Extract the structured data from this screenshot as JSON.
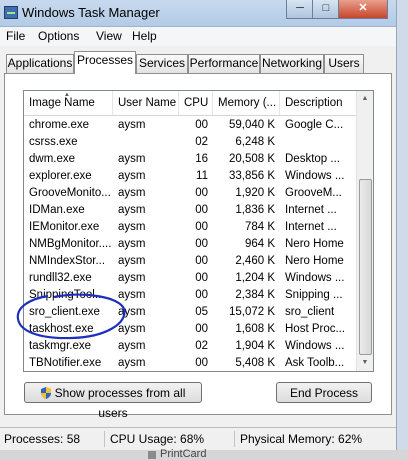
{
  "window": {
    "title": "Windows Task Manager",
    "min_glyph": "─",
    "max_glyph": "□",
    "close_glyph": "✕"
  },
  "menu": [
    "File",
    "Options",
    "View",
    "Help"
  ],
  "tabs": [
    "Applications",
    "Processes",
    "Services",
    "Performance",
    "Networking",
    "Users"
  ],
  "active_tab": "Processes",
  "columns": [
    "Image Name",
    "User Name",
    "CPU",
    "Memory (...",
    "Description"
  ],
  "processes": [
    {
      "name": "chrome.exe",
      "user": "aysm",
      "cpu": "00",
      "mem": "59,040 K",
      "desc": "Google C..."
    },
    {
      "name": "csrss.exe",
      "user": "",
      "cpu": "02",
      "mem": "6,248 K",
      "desc": ""
    },
    {
      "name": "dwm.exe",
      "user": "aysm",
      "cpu": "16",
      "mem": "20,508 K",
      "desc": "Desktop ..."
    },
    {
      "name": "explorer.exe",
      "user": "aysm",
      "cpu": "11",
      "mem": "33,856 K",
      "desc": "Windows ..."
    },
    {
      "name": "GrooveMonito...",
      "user": "aysm",
      "cpu": "00",
      "mem": "1,920 K",
      "desc": "GrooveM..."
    },
    {
      "name": "IDMan.exe",
      "user": "aysm",
      "cpu": "00",
      "mem": "1,836 K",
      "desc": "Internet ..."
    },
    {
      "name": "IEMonitor.exe",
      "user": "aysm",
      "cpu": "00",
      "mem": "784 K",
      "desc": "Internet ..."
    },
    {
      "name": "NMBgMonitor....",
      "user": "aysm",
      "cpu": "00",
      "mem": "964 K",
      "desc": "Nero Home"
    },
    {
      "name": "NMIndexStor...",
      "user": "aysm",
      "cpu": "00",
      "mem": "2,460 K",
      "desc": "Nero Home"
    },
    {
      "name": "rundll32.exe",
      "user": "aysm",
      "cpu": "00",
      "mem": "1,204 K",
      "desc": "Windows ..."
    },
    {
      "name": "SnippingTool...",
      "user": "aysm",
      "cpu": "00",
      "mem": "2,384 K",
      "desc": "Snipping ..."
    },
    {
      "name": "sro_client.exe",
      "user": "aysm",
      "cpu": "05",
      "mem": "15,072 K",
      "desc": "sro_client"
    },
    {
      "name": "taskhost.exe",
      "user": "aysm",
      "cpu": "00",
      "mem": "1,608 K",
      "desc": "Host Proc..."
    },
    {
      "name": "taskmgr.exe",
      "user": "aysm",
      "cpu": "02",
      "mem": "1,904 K",
      "desc": "Windows ..."
    },
    {
      "name": "TBNotifier.exe",
      "user": "aysm",
      "cpu": "00",
      "mem": "5,408 K",
      "desc": "Ask Toolb..."
    }
  ],
  "buttons": {
    "show_all": "Show processes from all users",
    "end_process": "End Process"
  },
  "status": {
    "processes": "Processes: 58",
    "cpu": "CPU Usage: 68%",
    "memory": "Physical Memory: 62%"
  },
  "background_text": "PrintCard",
  "colors": {
    "annotation": "#1d2fbf",
    "titlebar": "#b9cee8",
    "close": "#c7452b"
  }
}
